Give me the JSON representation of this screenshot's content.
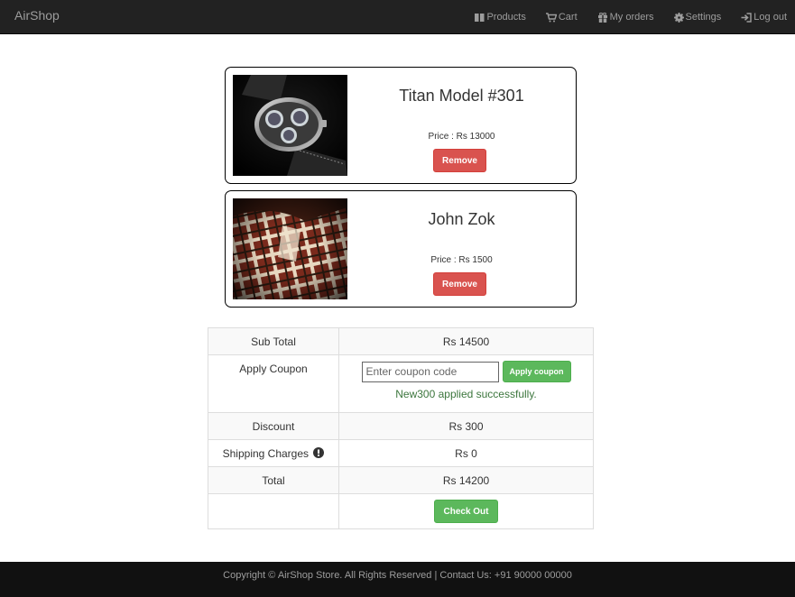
{
  "navbar": {
    "brand": "AirShop",
    "items": [
      {
        "label": "Products",
        "icon": "th-large-icon"
      },
      {
        "label": "Cart",
        "icon": "shopping-cart-icon"
      },
      {
        "label": "My orders",
        "icon": "gift-icon"
      },
      {
        "label": "Settings",
        "icon": "cog-icon"
      },
      {
        "label": "Log out",
        "icon": "log-in-icon"
      }
    ]
  },
  "cart": {
    "items": [
      {
        "name": "Titan Model #301",
        "price": "Price : Rs 13000",
        "remove_label": "Remove",
        "image": "wristwatch photo"
      },
      {
        "name": "John Zok",
        "price": "Price : Rs 1500",
        "remove_label": "Remove",
        "image": "plaid shirt photo"
      }
    ]
  },
  "summary": {
    "subtotal_label": "Sub Total",
    "subtotal_value": "Rs 14500",
    "coupon_label": "Apply Coupon",
    "coupon_placeholder": "Enter coupon code",
    "coupon_value": "",
    "apply_coupon_label": "Apply coupon",
    "coupon_message": "New300 applied successfully.",
    "discount_label": "Discount",
    "discount_value": "Rs 300",
    "shipping_label": "Shipping Charges",
    "shipping_value": "Rs 0",
    "total_label": "Total",
    "total_value": "Rs 14200",
    "checkout_label": "Check Out"
  },
  "footer": {
    "text": "Copyright © AirShop Store. All Rights Reserved | Contact Us: +91 90000 00000"
  },
  "colors": {
    "navbar_bg": "#222222",
    "footer_bg": "#111111",
    "danger": "#d9534f",
    "success": "#5cb85c",
    "success_text": "#3c763d"
  }
}
